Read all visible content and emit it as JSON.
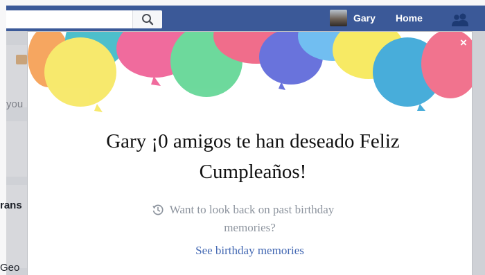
{
  "topbar": {
    "user_name": "Gary",
    "home_label": "Home",
    "accent_color": "#3b5998"
  },
  "background_page": {
    "fragments": [
      "you",
      "rans",
      "Geo"
    ]
  },
  "modal": {
    "title_line1": "Gary ¡0 amigos te han deseado Feliz",
    "title_line2": "Cumpleaños!",
    "memories_question_line1": "Want to look back on past birthday",
    "memories_question_line2": "memories?",
    "memories_link": "See birthday memories",
    "close_label": "×",
    "link_color": "#4267b2"
  },
  "icons": [
    "search-icon",
    "friends-icon",
    "history-icon",
    "close-icon",
    "balloons-illustration"
  ]
}
